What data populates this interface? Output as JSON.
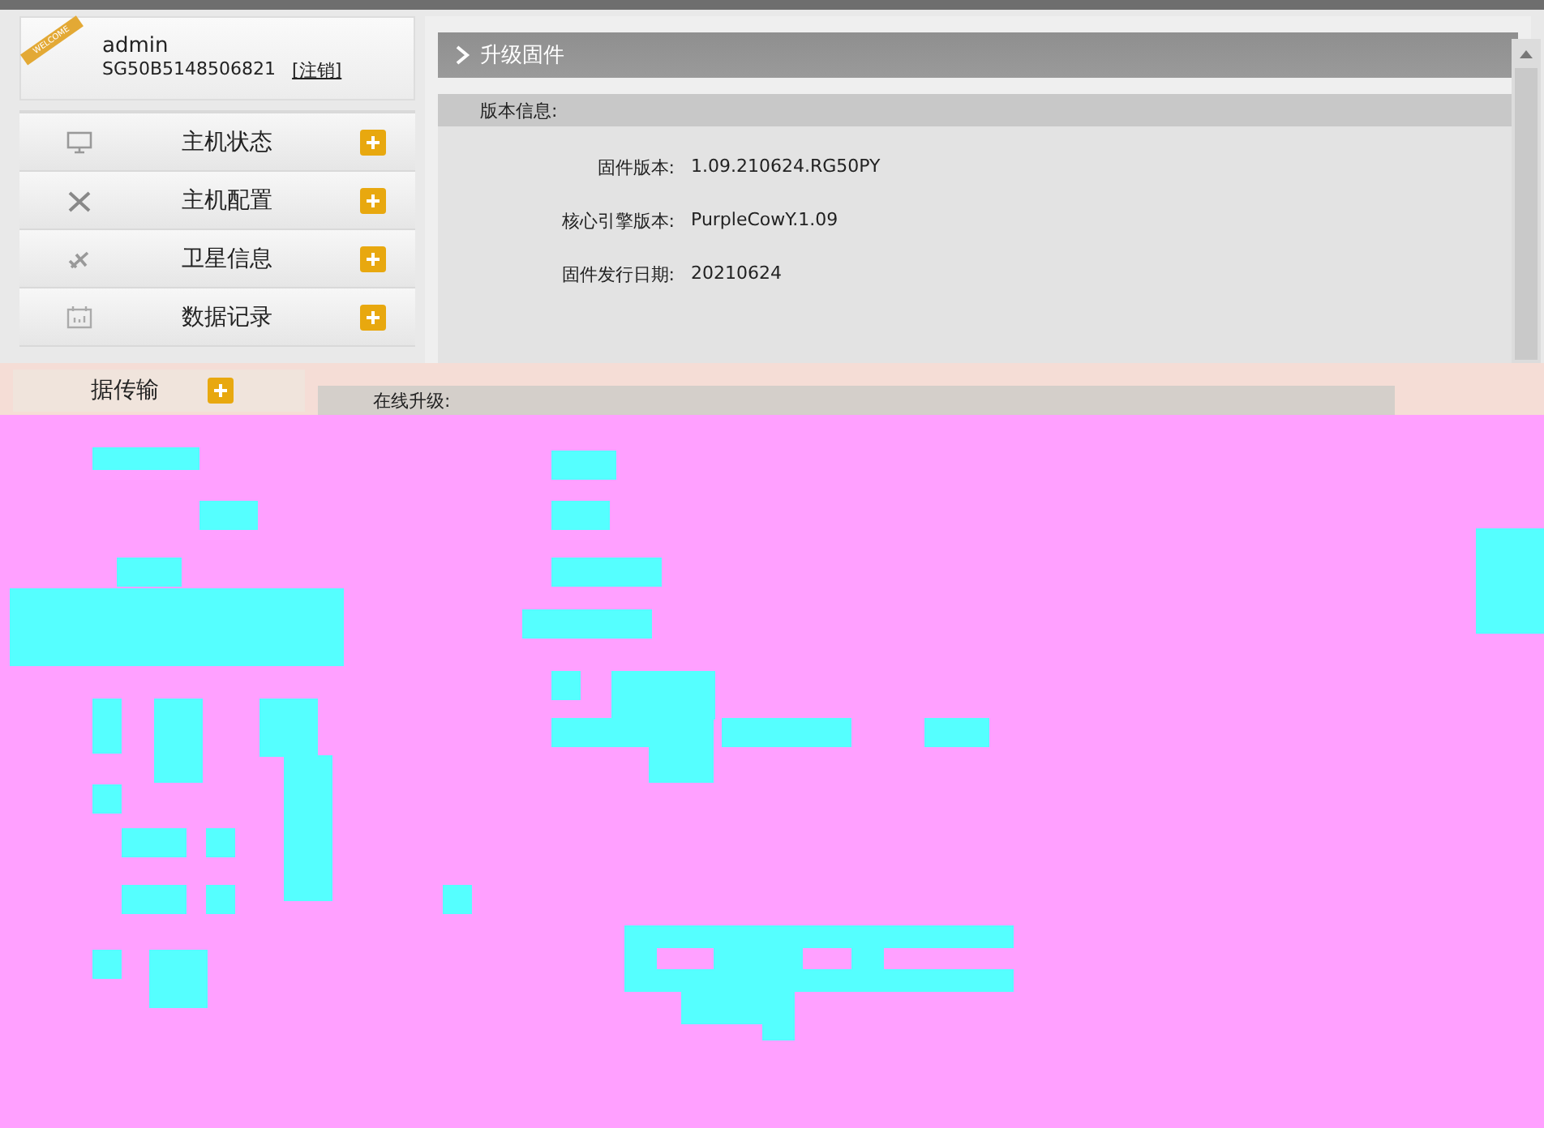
{
  "user": {
    "badge": "WELCOME",
    "name": "admin",
    "serial": "SG50B5148506821",
    "logout": "[注销]"
  },
  "sidebar": {
    "items": [
      {
        "label": "主机状态"
      },
      {
        "label": "主机配置"
      },
      {
        "label": "卫星信息"
      },
      {
        "label": "数据记录"
      },
      {
        "label": "据传输"
      }
    ]
  },
  "panel": {
    "title": "升级固件",
    "section": "版本信息:",
    "fields": [
      {
        "label": "固件版本:",
        "value": "1.09.210624.RG50PY"
      },
      {
        "label": "核心引擎版本:",
        "value": "PurpleCowY.1.09"
      },
      {
        "label": "固件发行日期:",
        "value": "20210624"
      }
    ],
    "online_section": "在线升级:"
  }
}
